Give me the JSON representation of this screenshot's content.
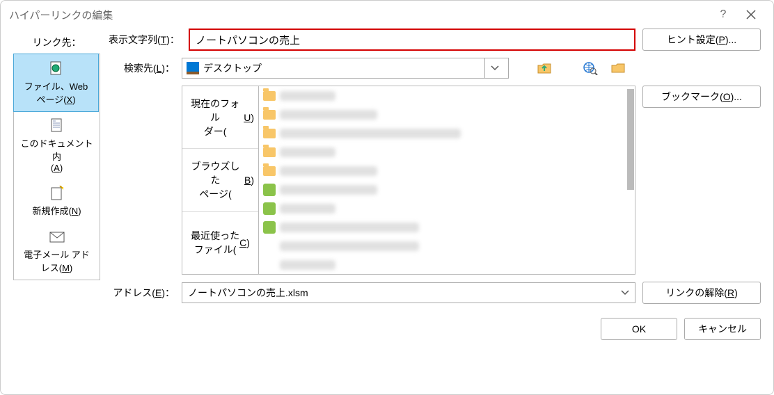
{
  "title": "ハイパーリンクの編集",
  "linkto_label": "リンク先：",
  "linkto": {
    "file_web": "ファイル、Web\nページ(X)",
    "this_doc": "このドキュメント内\n(A)",
    "new_create": "新規作成(N)",
    "email": "電子メール アド\nレス(M)"
  },
  "display_label": "表示文字列(T)：",
  "display_value": "ノートパソコンの売上",
  "search_label": "検索先(L)：",
  "search_value": "デスクトップ",
  "tabs": {
    "current_folder": "現在のフォル\nダー(U)",
    "browsed_pages": "ブラウズした\nページ(B)",
    "recent_files": "最近使った\nファイル(C)"
  },
  "address_label": "アドレス(E)：",
  "address_value": "ノートパソコンの売上.xlsm",
  "buttons": {
    "hint": "ヒント設定(P)...",
    "bookmark": "ブックマーク(O)...",
    "remove_link": "リンクの解除(R)",
    "ok": "OK",
    "cancel": "キャンセル"
  }
}
